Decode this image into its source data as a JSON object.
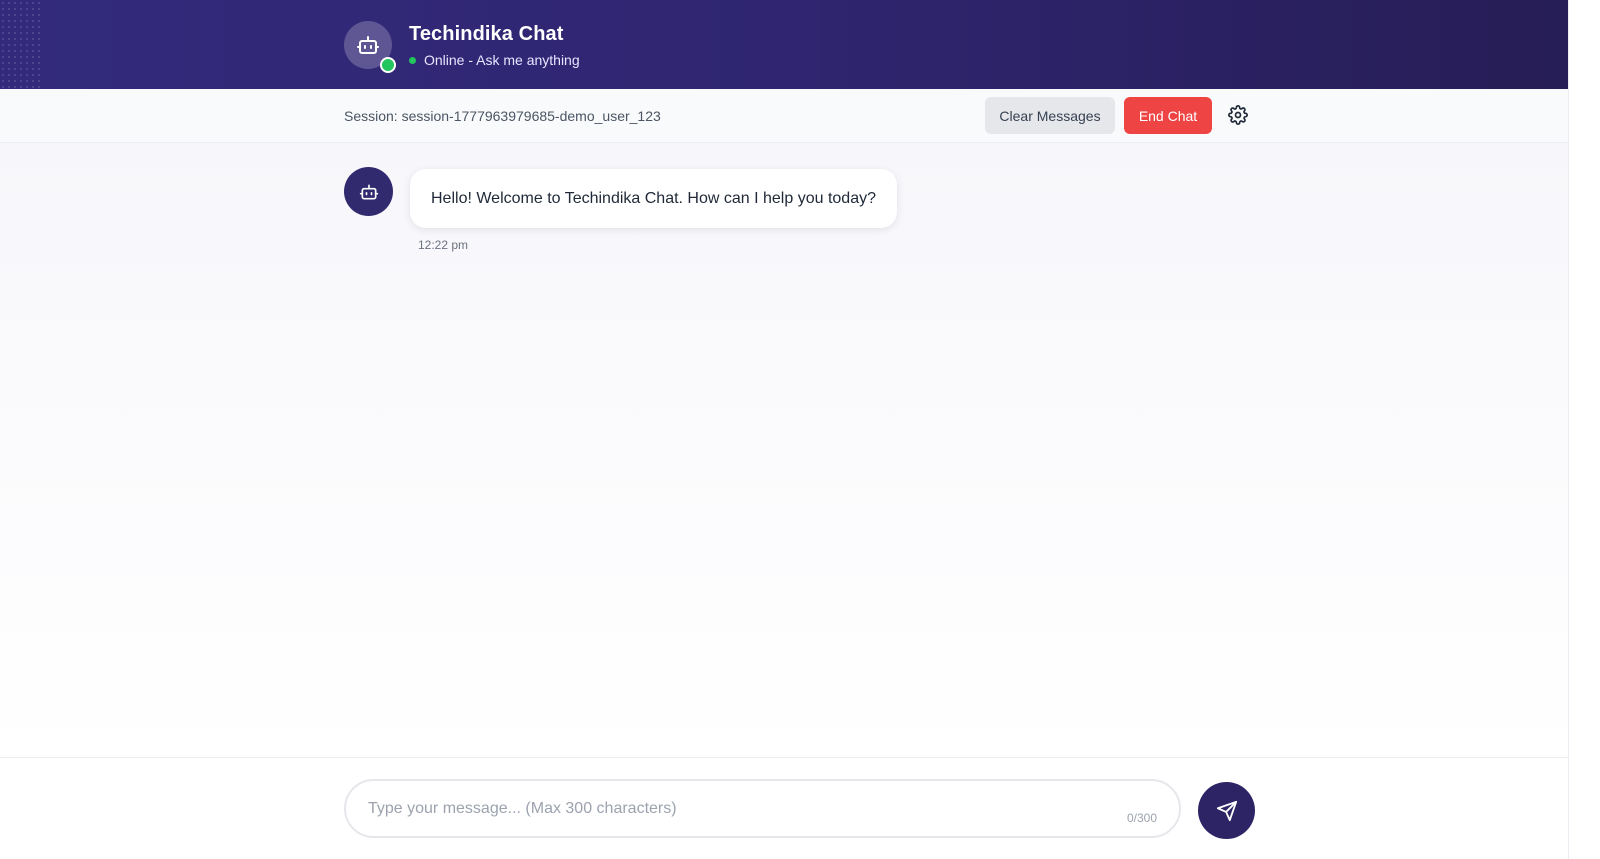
{
  "header": {
    "title": "Techindika Chat",
    "status": "Online - Ask me anything"
  },
  "session": {
    "label": "Session: session-1777963979685-demo_user_123",
    "clear_label": "Clear Messages",
    "end_label": "End Chat"
  },
  "messages": [
    {
      "sender": "bot",
      "text": "Hello! Welcome to Techindika Chat. How can I help you today?",
      "time": "12:22 pm"
    }
  ],
  "composer": {
    "placeholder": "Type your message... (Max 300 characters)",
    "value": "",
    "char_count": "0/300"
  },
  "icons": {
    "header_avatar": "robot-icon",
    "bot_avatar": "robot-icon",
    "settings": "gear-icon",
    "send": "send-icon"
  },
  "colors": {
    "header_bg": "#2f2570",
    "online": "#22c55e",
    "end_button": "#ef4444",
    "clear_button": "#e5e7eb",
    "send_button": "#2d2466",
    "bot_avatar_bg": "#312a6e"
  }
}
